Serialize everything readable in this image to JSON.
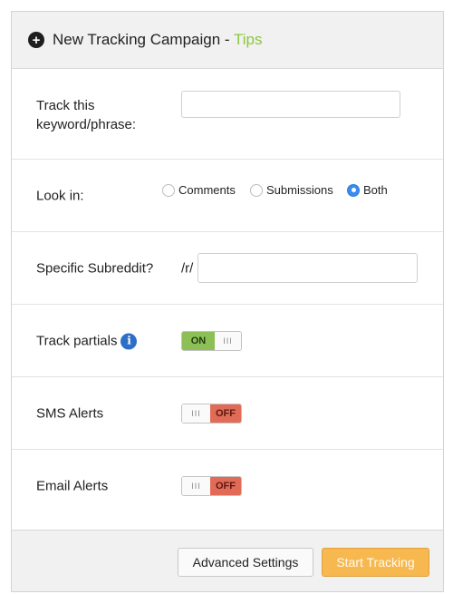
{
  "header": {
    "icon": "plus-circle-icon",
    "title": "New Tracking Campaign - ",
    "tips_link": "Tips",
    "tips_color": "#8cc63f"
  },
  "keyword": {
    "label": "Track this keyword/phrase:",
    "value": "",
    "placeholder": ""
  },
  "look_in": {
    "label": "Look in:",
    "options": [
      "Comments",
      "Submissions",
      "Both"
    ],
    "selected": "Both"
  },
  "subreddit": {
    "label": "Specific Subreddit?",
    "prefix": "/r/",
    "value": "",
    "placeholder": ""
  },
  "track_partials": {
    "label": "Track partials",
    "state": "ON",
    "info_icon": "info-icon"
  },
  "sms_alerts": {
    "label": "SMS Alerts",
    "state": "OFF"
  },
  "email_alerts": {
    "label": "Email Alerts",
    "state": "OFF"
  },
  "footer": {
    "advanced_label": "Advanced Settings",
    "start_label": "Start Tracking",
    "start_color": "#f7b94f"
  }
}
